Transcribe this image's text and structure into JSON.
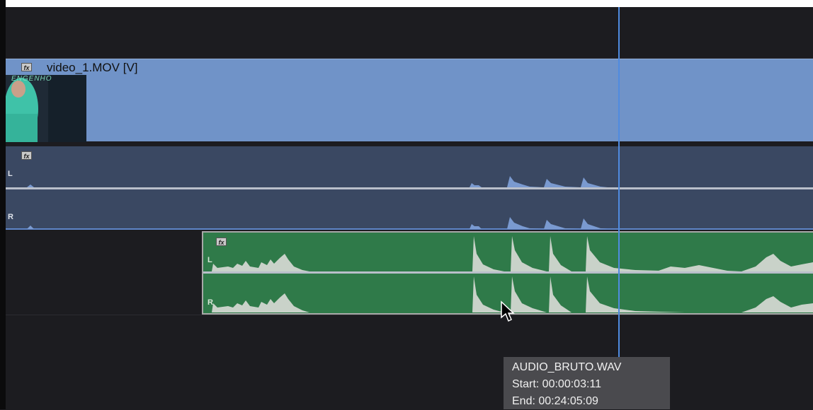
{
  "video_track": {
    "clip_name": "video_1.MOV [V]",
    "fx_label": "fx",
    "thumbnail_text": "ENGENHO"
  },
  "linked_audio": {
    "fx_label": "fx",
    "left_channel": "L",
    "right_channel": "R"
  },
  "audio_clip": {
    "fx_label": "fx",
    "left_channel": "L",
    "right_channel": "R"
  },
  "tooltip": {
    "filename": "AUDIO_BRUTO.WAV",
    "start": "Start: 00:00:03:11",
    "end": "End: 00:24:05:09"
  },
  "colors": {
    "video_clip": "#7093c8",
    "linked_audio": "#3a4862",
    "audio_clip": "#2f7a49",
    "playhead": "#4f8be0"
  }
}
